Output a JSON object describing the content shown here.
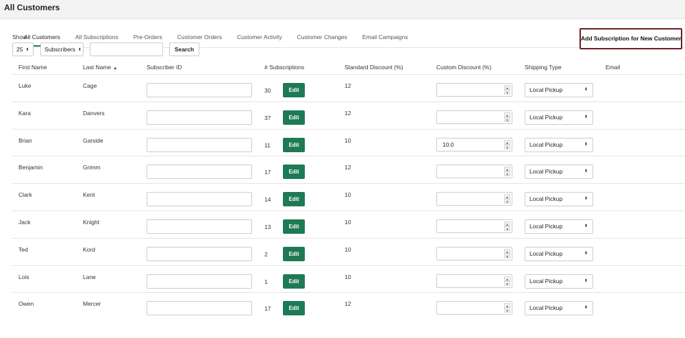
{
  "page": {
    "title": "All Customers"
  },
  "tabs": [
    {
      "label": "All Customers",
      "active": true
    },
    {
      "label": "All Subscriptions"
    },
    {
      "label": "Pre-Orders"
    },
    {
      "label": "Customer Orders"
    },
    {
      "label": "Customer Activity"
    },
    {
      "label": "Customer Changes"
    },
    {
      "label": "Email Campaigns"
    }
  ],
  "toolbar": {
    "show_label": "Show",
    "page_size": "25",
    "filter": "Subscribers",
    "search_value": "",
    "search_label": "Search",
    "add_label": "Add Subscription for New Customer"
  },
  "columns": {
    "first_name": "First Name",
    "last_name": "Last Name",
    "subscriber_id": "Subscriber ID",
    "subscriptions": "# Subscriptions",
    "standard_discount": "Standard Discount (%)",
    "custom_discount": "Custom Discount (%)",
    "shipping_type": "Shipping Type",
    "email": "Email"
  },
  "edit_label": "Edit",
  "icons": {
    "sort_asc": "▲",
    "select_arrow": "⬍",
    "spin_up": "▲",
    "spin_down": "▼"
  },
  "colors": {
    "accent": "#1e7a55",
    "add_button_border": "#6b1a22"
  },
  "rows": [
    {
      "first": "Luke",
      "last": "Cage",
      "subscriber_id": "",
      "subscriptions": "30",
      "standard": "12",
      "custom": "",
      "shipping": "Local Pickup"
    },
    {
      "first": "Kara",
      "last": "Danvers",
      "subscriber_id": "",
      "subscriptions": "37",
      "standard": "12",
      "custom": "",
      "shipping": "Local Pickup"
    },
    {
      "first": "Brian",
      "last": "Garside",
      "subscriber_id": "",
      "subscriptions": "11",
      "standard": "10",
      "custom": "10.0",
      "shipping": "Local Pickup"
    },
    {
      "first": "Benjamin",
      "last": "Grimm",
      "subscriber_id": "",
      "subscriptions": "17",
      "standard": "12",
      "custom": "",
      "shipping": "Local Pickup"
    },
    {
      "first": "Clark",
      "last": "Kent",
      "subscriber_id": "",
      "subscriptions": "14",
      "standard": "10",
      "custom": "",
      "shipping": "Local Pickup"
    },
    {
      "first": "Jack",
      "last": "Knight",
      "subscriber_id": "",
      "subscriptions": "13",
      "standard": "10",
      "custom": "",
      "shipping": "Local Pickup"
    },
    {
      "first": "Ted",
      "last": "Kord",
      "subscriber_id": "",
      "subscriptions": "2",
      "standard": "10",
      "custom": "",
      "shipping": "Local Pickup"
    },
    {
      "first": "Lois",
      "last": "Lane",
      "subscriber_id": "",
      "subscriptions": "1",
      "standard": "10",
      "custom": "",
      "shipping": "Local Pickup"
    },
    {
      "first": "Owen",
      "last": "Mercer",
      "subscriber_id": "",
      "subscriptions": "17",
      "standard": "12",
      "custom": "",
      "shipping": "Local Pickup"
    }
  ]
}
